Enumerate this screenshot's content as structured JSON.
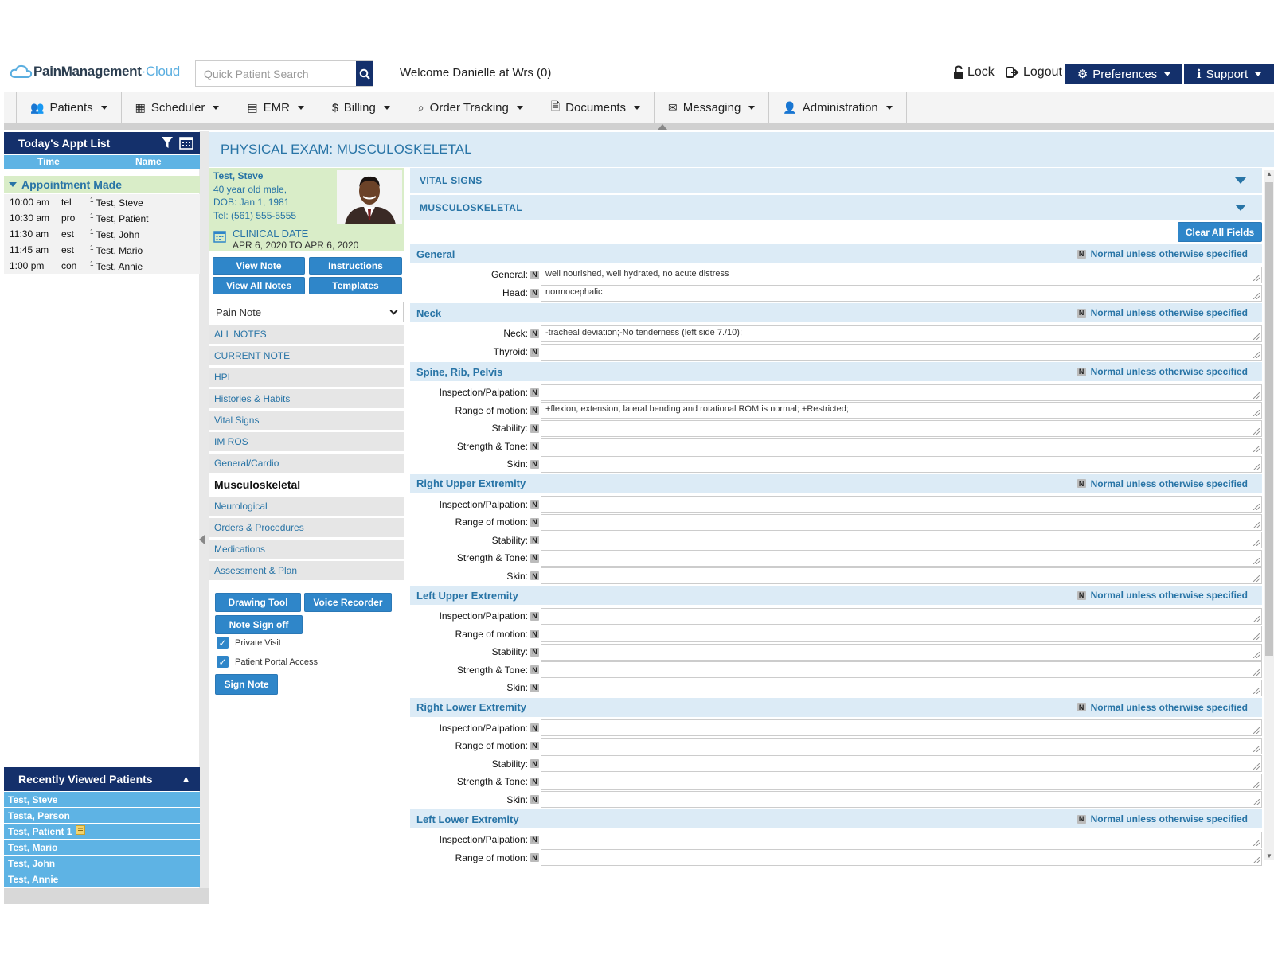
{
  "header": {
    "logo_part1": "PainManagement",
    "logo_part2": "Cloud",
    "search_placeholder": "Quick Patient Search",
    "welcome": "Welcome Danielle at Wrs (0)",
    "lock": "Lock",
    "logout": "Logout",
    "preferences": "Preferences",
    "support": "Support"
  },
  "nav": [
    {
      "label": "Patients",
      "icon": "users-icon",
      "glyph": "👥"
    },
    {
      "label": "Scheduler",
      "icon": "calendar-icon",
      "glyph": "▦"
    },
    {
      "label": "EMR",
      "icon": "emr-icon",
      "glyph": "▤"
    },
    {
      "label": "Billing",
      "icon": "dollar-icon",
      "glyph": "$"
    },
    {
      "label": "Order Tracking",
      "icon": "search-icon",
      "glyph": "⌕"
    },
    {
      "label": "Documents",
      "icon": "document-icon",
      "glyph": "🗎"
    },
    {
      "label": "Messaging",
      "icon": "envelope-icon",
      "glyph": "✉"
    },
    {
      "label": "Administration",
      "icon": "user-icon",
      "glyph": "👤"
    }
  ],
  "appts": {
    "title": "Today's Appt List",
    "col_time": "Time",
    "col_name": "Name",
    "group": "Appointment Made",
    "rows": [
      {
        "time": "10:00 am",
        "type": "tel",
        "sup": "1",
        "name": "Test, Steve"
      },
      {
        "time": "10:30 am",
        "type": "pro",
        "sup": "1",
        "name": "Test, Patient"
      },
      {
        "time": "11:30 am",
        "type": "est",
        "sup": "1",
        "name": "Test, John"
      },
      {
        "time": "11:45 am",
        "type": "est",
        "sup": "1",
        "name": "Test, Mario"
      },
      {
        "time": "1:00 pm",
        "type": "con",
        "sup": "1",
        "name": "Test, Annie"
      }
    ]
  },
  "recent": {
    "title": "Recently Viewed Patients",
    "items": [
      "Test, Steve",
      "Testa, Person",
      "Test, Patient 1",
      "Test, Mario",
      "Test, John",
      "Test, Annie"
    ]
  },
  "page": {
    "title": "PHYSICAL EXAM: MUSCULOSKELETAL"
  },
  "patient": {
    "name": "Test, Steve",
    "age": "40 year old male,",
    "dob": "DOB: Jan 1, 1981",
    "tel": "Tel: (561) 555-5555",
    "clinical_label": "CLINICAL DATE",
    "clinical_range": "APR 6, 2020 TO APR 6, 2020"
  },
  "buttons": {
    "view_note": "View Note",
    "instructions": "Instructions",
    "view_all": "View All Notes",
    "templates": "Templates",
    "drawing": "Drawing Tool",
    "voice": "Voice Recorder",
    "signoff": "Note Sign off",
    "sign": "Sign Note",
    "clear": "Clear All Fields"
  },
  "note_select": "Pain Note",
  "notes_nav": [
    "ALL NOTES",
    "CURRENT NOTE",
    "HPI",
    "Histories & Habits",
    "Vital Signs",
    "IM ROS",
    "General/Cardio",
    "Musculoskeletal",
    "Neurological",
    "Orders & Procedures",
    "Medications",
    "Assessment & Plan"
  ],
  "checks": {
    "private": "Private Visit",
    "portal": "Patient Portal Access"
  },
  "form": {
    "acc1": "VITAL SIGNS",
    "acc2": "MUSCULOSKELETAL",
    "n": "N",
    "normal": "Normal unless otherwise specified",
    "sections": [
      {
        "name": "General",
        "fields": [
          {
            "label": "General:",
            "value": "well nourished, well hydrated, no acute distress"
          },
          {
            "label": "Head:",
            "value": "normocephalic"
          }
        ]
      },
      {
        "name": "Neck",
        "fields": [
          {
            "label": "Neck:",
            "value": "-tracheal deviation;-No tenderness (left side 7./10);"
          },
          {
            "label": "Thyroid:",
            "value": ""
          }
        ]
      },
      {
        "name": "Spine, Rib, Pelvis",
        "fields": [
          {
            "label": "Inspection/Palpation:",
            "value": ""
          },
          {
            "label": "Range of motion:",
            "value": "+flexion, extension, lateral bending and rotational ROM is normal; +Restricted;"
          },
          {
            "label": "Stability:",
            "value": ""
          },
          {
            "label": "Strength & Tone:",
            "value": ""
          },
          {
            "label": "Skin:",
            "value": ""
          }
        ]
      },
      {
        "name": "Right Upper Extremity",
        "fields": [
          {
            "label": "Inspection/Palpation:",
            "value": ""
          },
          {
            "label": "Range of motion:",
            "value": ""
          },
          {
            "label": "Stability:",
            "value": ""
          },
          {
            "label": "Strength & Tone:",
            "value": ""
          },
          {
            "label": "Skin:",
            "value": ""
          }
        ]
      },
      {
        "name": "Left Upper Extremity",
        "fields": [
          {
            "label": "Inspection/Palpation:",
            "value": ""
          },
          {
            "label": "Range of motion:",
            "value": ""
          },
          {
            "label": "Stability:",
            "value": ""
          },
          {
            "label": "Strength & Tone:",
            "value": ""
          },
          {
            "label": "Skin:",
            "value": ""
          }
        ]
      },
      {
        "name": "Right Lower Extremity",
        "fields": [
          {
            "label": "Inspection/Palpation:",
            "value": ""
          },
          {
            "label": "Range of motion:",
            "value": ""
          },
          {
            "label": "Stability:",
            "value": ""
          },
          {
            "label": "Strength & Tone:",
            "value": ""
          },
          {
            "label": "Skin:",
            "value": ""
          }
        ]
      },
      {
        "name": "Left Lower Extremity",
        "fields": [
          {
            "label": "Inspection/Palpation:",
            "value": ""
          },
          {
            "label": "Range of motion:",
            "value": ""
          }
        ]
      }
    ]
  }
}
